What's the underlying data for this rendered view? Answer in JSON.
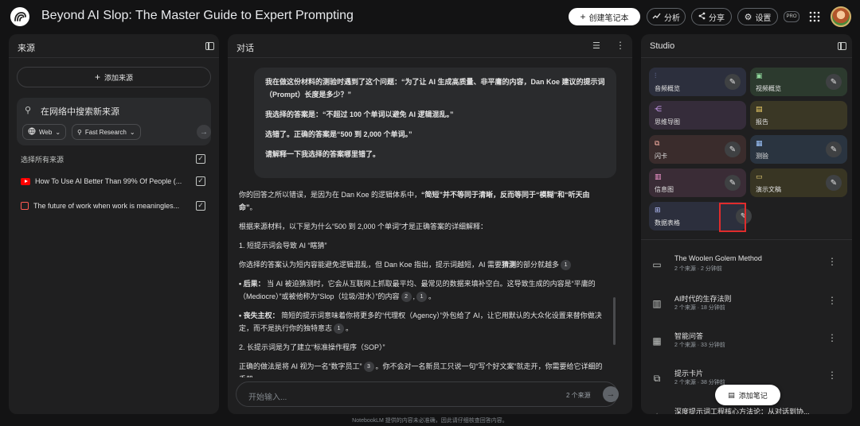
{
  "header": {
    "title": "Beyond AI Slop: The Master Guide to Expert Prompting",
    "create_notebook": "创建笔记本",
    "analyze": "分析",
    "share": "分享",
    "settings": "设置",
    "pro_badge": "PRO"
  },
  "sources": {
    "title": "来源",
    "add_source": "添加来源",
    "search_placeholder": "在网络中搜索新来源",
    "chip_web": "Web",
    "chip_research": "Fast Research",
    "select_all": "选择所有来源",
    "items": [
      {
        "label": "How To Use AI Better Than 99% Of People (...",
        "type": "youtube",
        "checked": true
      },
      {
        "label": "The future of work when work is meaningles...",
        "type": "document",
        "checked": true
      }
    ]
  },
  "chat": {
    "title": "对话",
    "user_message": [
      "我在做这份材料的测验时遇到了这个问题：“为了让 AI 生成高质量、非平庸的内容，Dan Koe 建议的提示词（Prompt）长度是多少？”",
      "我选择的答案是：“不超过 100 个单词以避免 AI 逻辑混乱。”",
      "选错了。正确的答案是“500 到 2,000 个单词。”",
      "请解释一下我选择的答案哪里错了。"
    ],
    "answer": {
      "p1_a": "你的回答之所以错误，是因为在 Dan Koe 的逻辑体系中，",
      "p1_b": "“简短”并不等同于清晰，反而等同于“模糊”和“听天由命”",
      "p1_c": "。",
      "p2": "根据来源材料，以下是为什么“500 到 2,000 个单词”才是正确答案的详细解释：",
      "h1": "1. 短提示词会导致 AI “瞎猜”",
      "p3_a": "你选择的答案认为短内容能避免逻辑混乱，但 Dan Koe 指出，提示词越短，AI 需要",
      "p3_b": "猜测",
      "p3_c": "的部分就越多",
      "b1_label": "• 后果：",
      "b1_text": "当 AI 被迫猜测时，它会从互联网上抓取最平均、最常见的数据来填补空白。这导致生成的内容是“平庸的（Mediocre）”或被他称为“Slop（垃圾/泔水）”的内容",
      "b2_label": "• 丧失主权：",
      "b2_text": "简短的提示词意味着你将更多的“代理权（Agency）”外包给了 AI，让它用默认的大众化设置来替你做决定，而不是执行你的独特意志",
      "h2": "2. 长提示词是为了建立“标准操作程序（SOP）”",
      "p4": "正确的做法是将 AI 视为一名“数字员工”",
      "p4_b": "。你不会对一名新员工只说一句“写个好文案”就走开，你需要给它详细的手册。"
    },
    "cites": {
      "c1": "1",
      "c2": "2",
      "c3": "1",
      "c4": "1",
      "c5": "3"
    },
    "input_placeholder": "开始输入...",
    "source_count": "2 个来源"
  },
  "studio": {
    "title": "Studio",
    "cards": [
      {
        "label": "音频概览",
        "icon": "audio-icon",
        "color": "#2c2f3d"
      },
      {
        "label": "视频概览",
        "icon": "video-icon",
        "color": "#2c3a2e"
      },
      {
        "label": "思维导图",
        "icon": "mindmap-icon",
        "color": "#352c3a"
      },
      {
        "label": "报告",
        "icon": "report-icon",
        "color": "#3a3725"
      },
      {
        "label": "闪卡",
        "icon": "flashcard-icon",
        "color": "#3a2c2c"
      },
      {
        "label": "测验",
        "icon": "quiz-icon",
        "color": "#2a3440"
      },
      {
        "label": "信息图",
        "icon": "infographic-icon",
        "color": "#3a2c36"
      },
      {
        "label": "演示文稿",
        "icon": "slides-icon",
        "color": "#383523"
      },
      {
        "label": "数据表格",
        "icon": "table-icon",
        "color": "#2c2f3d"
      }
    ],
    "notes": [
      {
        "title": "The Woolen Golem Method",
        "meta": "2 个来源 · 2 分钟前",
        "icon": "slides-icon"
      },
      {
        "title": "AI时代的生存法则",
        "meta": "2 个来源 · 18 分钟前",
        "icon": "infographic-icon"
      },
      {
        "title": "智能问答",
        "meta": "2 个来源 · 33 分钟前",
        "icon": "quiz-icon"
      },
      {
        "title": "提示卡片",
        "meta": "2 个来源 · 38 分钟前",
        "icon": "flashcard-icon"
      },
      {
        "title": "深度提示词工程核心方法论：从对话到协...",
        "meta": "",
        "icon": "sparkle-icon"
      }
    ],
    "add_note": "添加笔记"
  },
  "footer": "NotebookLM 提供的内容未必准确，因此请仔细核查回答内容。"
}
